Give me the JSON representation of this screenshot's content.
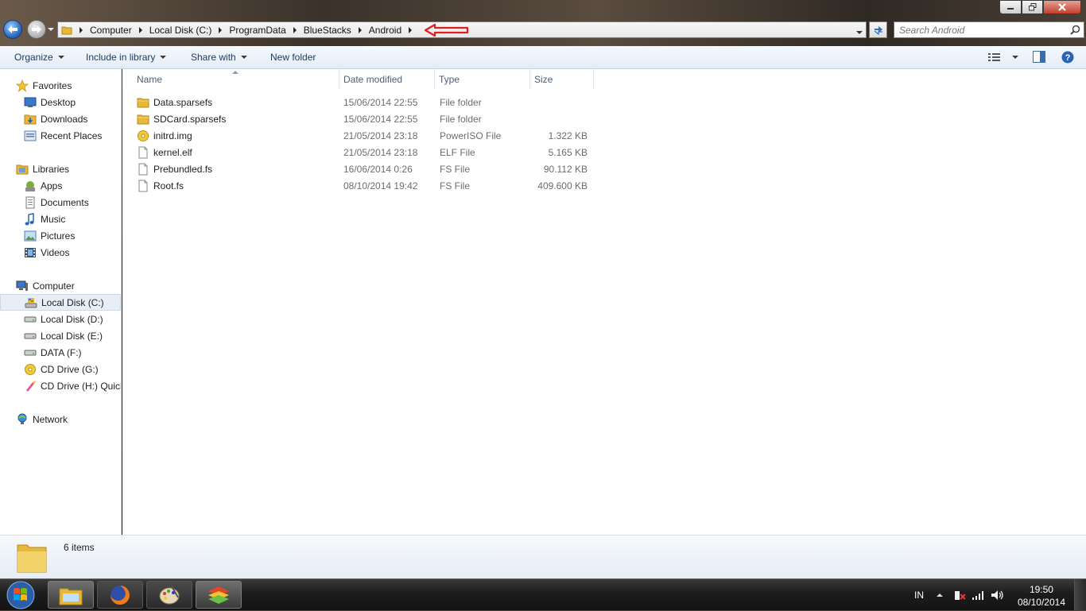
{
  "window": {
    "minimize_icon": "minimize-icon",
    "maximize_icon": "restore-icon",
    "close_icon": "close-icon"
  },
  "address": {
    "crumbs": [
      "Computer",
      "Local Disk (C:)",
      "ProgramData",
      "BlueStacks",
      "Android"
    ],
    "annotation": "red-arrow"
  },
  "search": {
    "placeholder": "Search Android"
  },
  "toolbar": {
    "organize": "Organize",
    "include_in_library": "Include in library",
    "share_with": "Share with",
    "new_folder": "New folder"
  },
  "nav": {
    "favorites": "Favorites",
    "desktop": "Desktop",
    "downloads": "Downloads",
    "recent_places": "Recent Places",
    "libraries": "Libraries",
    "apps": "Apps",
    "documents": "Documents",
    "music": "Music",
    "pictures": "Pictures",
    "videos": "Videos",
    "computer": "Computer",
    "drive_c": "Local Disk (C:)",
    "drive_d": "Local Disk (D:)",
    "drive_e": "Local Disk (E:)",
    "drive_f": "DATA (F:)",
    "drive_g": "CD Drive (G:)",
    "drive_h": "CD Drive (H:) Quick",
    "network": "Network"
  },
  "columns": {
    "name": "Name",
    "date_modified": "Date modified",
    "type": "Type",
    "size": "Size"
  },
  "files": [
    {
      "name": "Data.sparsefs",
      "date": "15/06/2014 22:55",
      "type": "File folder",
      "size": "",
      "icon": "folder-icon"
    },
    {
      "name": "SDCard.sparsefs",
      "date": "15/06/2014 22:55",
      "type": "File folder",
      "size": "",
      "icon": "folder-icon"
    },
    {
      "name": "initrd.img",
      "date": "21/05/2014 23:18",
      "type": "PowerISO File",
      "size": "1.322 KB",
      "icon": "disc-image-icon"
    },
    {
      "name": "kernel.elf",
      "date": "21/05/2014 23:18",
      "type": "ELF File",
      "size": "5.165 KB",
      "icon": "file-icon"
    },
    {
      "name": "Prebundled.fs",
      "date": "16/06/2014 0:26",
      "type": "FS File",
      "size": "90.112 KB",
      "icon": "file-icon"
    },
    {
      "name": "Root.fs",
      "date": "08/10/2014 19:42",
      "type": "FS File",
      "size": "409.600 KB",
      "icon": "file-icon"
    }
  ],
  "status": {
    "item_count": "6 items"
  },
  "taskbar": {
    "language": "IN",
    "time": "19:50",
    "date": "08/10/2014"
  },
  "colors": {
    "accent": "#1e395b",
    "annotation": "#e02020"
  }
}
